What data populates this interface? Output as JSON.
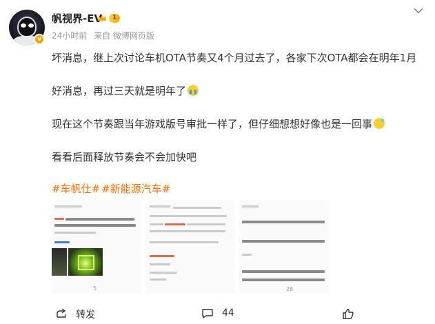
{
  "post": {
    "author": {
      "name": "帆视界-EV",
      "level": "1",
      "verified_icon": "v-badge-icon",
      "crown_icon": "crown-icon"
    },
    "meta": {
      "time": "24小时前",
      "source": "来自 微博网页版"
    },
    "paragraphs": [
      "坏消息，继上次讨论车机OTA节奏又4个月过去了，各家下次OTA都会在明年1月",
      "好消息，再过三天就是明年了",
      "现在这个节奏跟当年游戏版号审批一样了，但仔细想想好像也是一回事",
      "看看后面释放节奏会不会加快吧"
    ],
    "emoji": [
      "crying-face-emoji",
      "sweat-smile-emoji"
    ],
    "tags": [
      "#车帆仕#",
      "#新能源汽车#"
    ],
    "images": [
      {
        "name": "image-1",
        "count": "5"
      },
      {
        "name": "image-2",
        "count": ""
      },
      {
        "name": "image-3",
        "count": "28"
      }
    ],
    "actions": {
      "share_label": "转发",
      "comment_count": "44",
      "like_count": ""
    },
    "colors": {
      "accent_orange": "#ff6b00",
      "text": "#333333",
      "meta": "#9a9a9a",
      "level_badge": "#f6a800"
    }
  }
}
